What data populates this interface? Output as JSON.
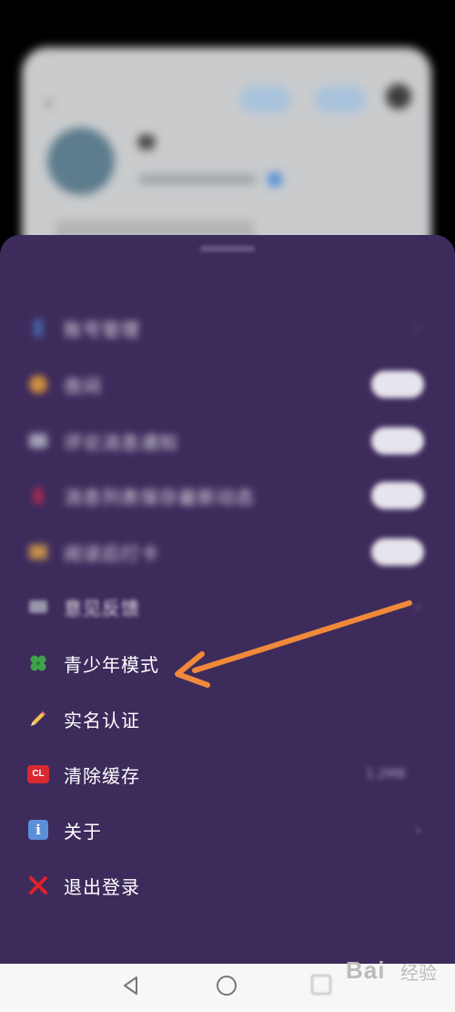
{
  "sheet": {
    "items": [
      {
        "label": "账号管理",
        "icon": "phone-icon",
        "control": "chevron"
      },
      {
        "label": "夜间",
        "icon": "night-mode-icon",
        "control": "toggle"
      },
      {
        "label": "评论消息通知",
        "icon": "chat-icon",
        "control": "toggle"
      },
      {
        "label": "消息列表保存最新动态",
        "icon": "pin-icon",
        "control": "toggle"
      },
      {
        "label": "阅读后打卡",
        "icon": "folder-icon",
        "control": "toggle"
      },
      {
        "label": "意见反馈",
        "icon": "feedback-icon",
        "control": "chevron"
      },
      {
        "label": "青少年模式",
        "icon": "clover-icon",
        "control": "none"
      },
      {
        "label": "实名认证",
        "icon": "pencil-icon",
        "control": "none"
      },
      {
        "label": "清除缓存",
        "icon": "cl-icon",
        "icon_text": "CL",
        "control": "value",
        "value": "1.2MB"
      },
      {
        "label": "关于",
        "icon": "info-icon",
        "icon_text": "i",
        "control": "chevron"
      },
      {
        "label": "退出登录",
        "icon": "cross-icon",
        "control": "none"
      }
    ]
  },
  "annotation": {
    "color": "#f08a3a"
  },
  "watermark": {
    "text": "Bai",
    "sub": "经验"
  }
}
